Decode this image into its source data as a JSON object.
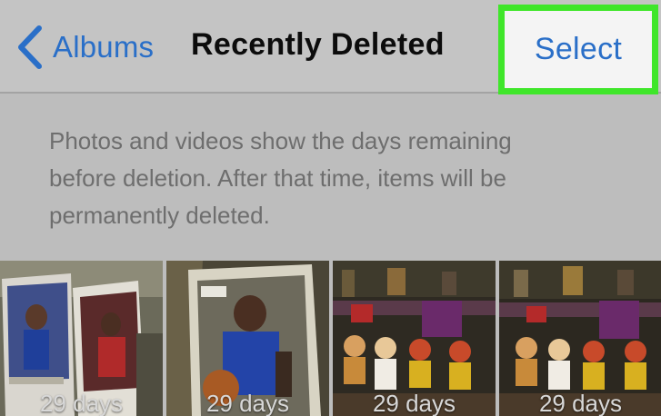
{
  "navbar": {
    "back_label": "Albums",
    "title": "Recently Deleted",
    "select_label": "Select"
  },
  "info": {
    "lines": [
      "Photos and videos show the days remaining",
      "before deletion. After that time, items will be",
      "permanently deleted."
    ]
  },
  "thumbnails": [
    {
      "days": "29 days",
      "subject": "basketball trading cards"
    },
    {
      "days": "29 days",
      "subject": "basketball trading card"
    },
    {
      "days": "29 days",
      "subject": "figurines shelf"
    },
    {
      "days": "29 days",
      "subject": "figurines shelf"
    }
  ],
  "colors": {
    "accent": "#2a6fc8",
    "highlight_border": "#3fe62a"
  }
}
